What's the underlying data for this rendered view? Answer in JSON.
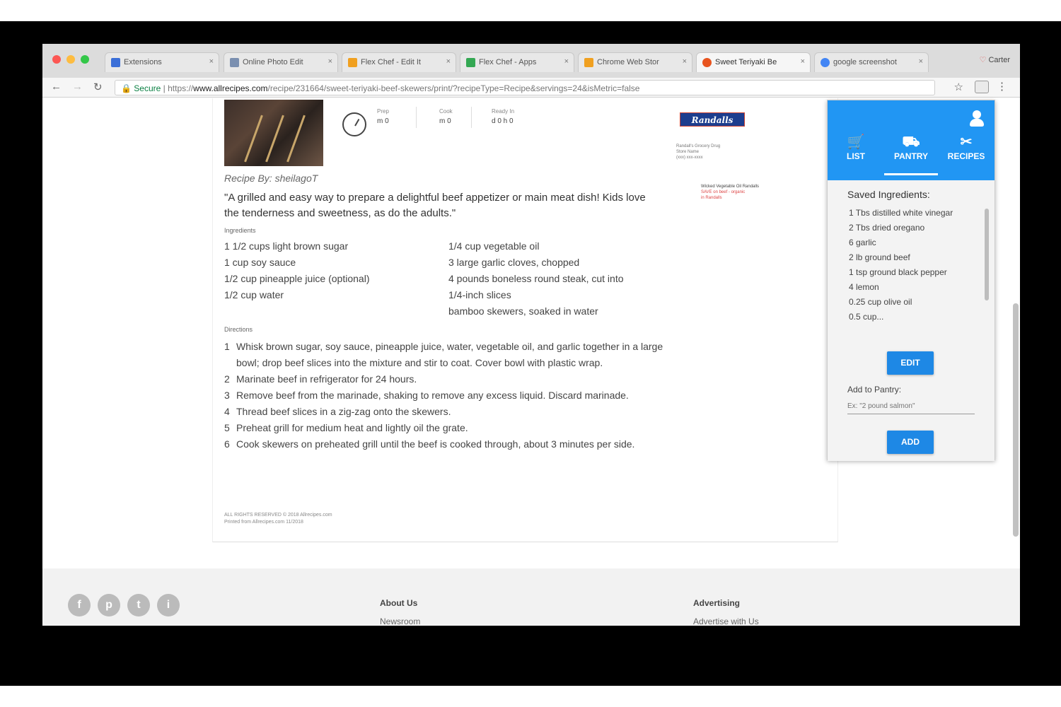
{
  "browser": {
    "tabs": [
      {
        "title": "Extensions",
        "favicon_color": "#3b6fd8"
      },
      {
        "title": "Online Photo Edit",
        "favicon_color": "#7a8fb0"
      },
      {
        "title": "Flex Chef - Edit It",
        "favicon_color": "#f0a020"
      },
      {
        "title": "Flex Chef - Apps",
        "favicon_color": "#34a853"
      },
      {
        "title": "Chrome Web Stor",
        "favicon_color": "#f0a020"
      },
      {
        "title": "Sweet Teriyaki Be",
        "favicon_color": "#e8541f"
      },
      {
        "title": "google screenshot",
        "favicon_color": "#4285f4"
      }
    ],
    "tab_close": "×",
    "user_name": "Carter",
    "nav": {
      "back": "←",
      "forward": "→",
      "reload": "↻"
    },
    "url": {
      "secure_label": "Secure",
      "scheme": "https://",
      "host": "www.allrecipes.com",
      "path": "/recipe/231664/sweet-teriyaki-beef-skewers/print/?recipeType=Recipe&servings=24&isMetric=false"
    },
    "star": "☆",
    "menu": "⋮"
  },
  "recipe": {
    "times": [
      {
        "label": "Prep",
        "value": "m 0"
      },
      {
        "label": "Cook",
        "value": "m 0"
      },
      {
        "label": "Ready In",
        "value": "d 0 h 0"
      }
    ],
    "brand": "Randalls",
    "brand_info": [
      "Randall's Grocery Drug",
      "Store Name",
      "(xxx) xxx-xxxx"
    ],
    "ad": {
      "title": "Wicked Vegetable Oil Randalls",
      "link": "SAVE on beef - organic",
      "link2": "in Randalls"
    },
    "byline": "Recipe By: sheilagoT",
    "description": "\"A grilled and easy way to prepare a delightful beef appetizer or main meat dish! Kids love the tenderness and sweetness, as do the adults.\"",
    "ingredients_label": "Ingredients",
    "ingredients_left": [
      "1 1/2 cups light brown sugar",
      "1 cup soy sauce",
      "1/2 cup pineapple juice (optional)",
      "1/2 cup water"
    ],
    "ingredients_right": [
      "1/4 cup vegetable oil",
      "3 large garlic cloves, chopped",
      "4 pounds boneless round steak, cut into",
      "1/4-inch slices",
      "bamboo skewers, soaked in water"
    ],
    "directions_label": "Directions",
    "directions": [
      "Whisk brown sugar, soy sauce, pineapple juice, water, vegetable oil, and garlic together in a large bowl; drop beef slices into the mixture and stir to coat. Cover bowl with plastic wrap.",
      "Marinate beef in refrigerator for 24 hours.",
      "Remove beef from the marinade, shaking to remove any excess liquid. Discard marinade.",
      "Thread beef slices in a zig-zag onto the skewers.",
      "Preheat grill for medium heat and lightly oil the grate.",
      "Cook skewers on preheated grill until the beef is cooked through, about 3 minutes per side."
    ],
    "footnote": [
      "ALL RIGHTS RESERVED © 2018 Allrecipes.com",
      "Printed from Allrecipes.com 11/2018"
    ]
  },
  "footer": {
    "social": [
      "f",
      "p",
      "t",
      "i"
    ],
    "col1_head": "About Us",
    "col1_link": "Newsroom",
    "col2_head": "Advertising",
    "col2_link": "Advertise with Us"
  },
  "popup": {
    "tabs": [
      {
        "icon": "🛒",
        "label": "LIST"
      },
      {
        "icon": "⛟",
        "label": "PANTRY"
      },
      {
        "icon": "✂",
        "label": "RECIPES"
      }
    ],
    "saved_title": "Saved Ingredients:",
    "saved_items": [
      "1 Tbs distilled white vinegar",
      "2 Tbs dried oregano",
      "6 garlic",
      "2 lb ground beef",
      "1 tsp ground black pepper",
      "4 lemon",
      "0.25 cup olive oil",
      "0.5 cup..."
    ],
    "edit_label": "EDIT",
    "add_label": "Add to Pantry:",
    "add_placeholder": "Ex: \"2 pound salmon\"",
    "add_button": "ADD",
    "accent": "#2196f3"
  }
}
